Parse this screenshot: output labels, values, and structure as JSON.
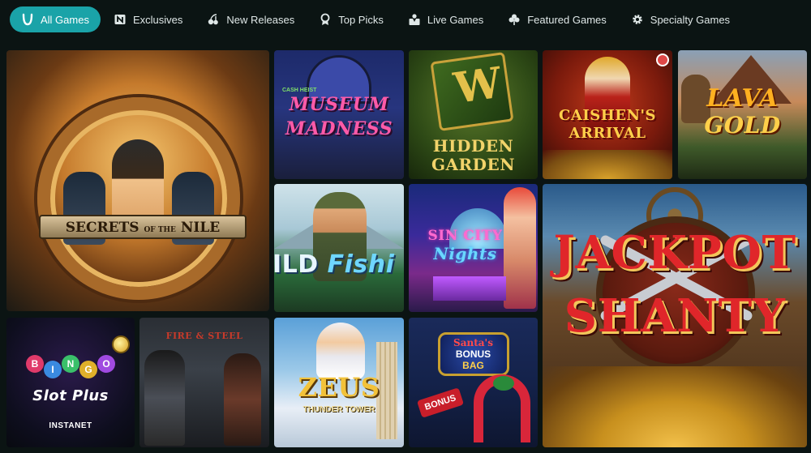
{
  "nav": {
    "items": [
      {
        "label": "All Games",
        "icon": "horseshoe-icon",
        "active": true
      },
      {
        "label": "Exclusives",
        "icon": "exclusives-badge-icon"
      },
      {
        "label": "New Releases",
        "icon": "cherries-icon"
      },
      {
        "label": "Top Picks",
        "icon": "award-ribbon-icon"
      },
      {
        "label": "Live Games",
        "icon": "live-dealer-icon"
      },
      {
        "label": "Featured Games",
        "icon": "clover-icon"
      },
      {
        "label": "Specialty Games",
        "icon": "gear-icon"
      }
    ]
  },
  "colors": {
    "background": "#0b1413",
    "accent": "#1aa3a8"
  },
  "games": {
    "secrets_nile": {
      "title_main": "SECRETS",
      "title_of": "OF THE",
      "title_end": "NILE"
    },
    "museum": {
      "tag": "CASH HEIST",
      "line1": "MUSEUM",
      "line2": "MADNESS"
    },
    "hidden_garden": {
      "line1": "HIDDEN",
      "line2": "GARDEN"
    },
    "caishens": {
      "line1": "CAISHEN'S",
      "line2": "ARRIVAL"
    },
    "lava_gold": {
      "line1": "LAVA",
      "line2": "GOLD"
    },
    "wild_fishin": {
      "line1": "ILD",
      "line2": "Fishi"
    },
    "sin_city": {
      "line1": "SIN CITY",
      "line2": "Nights"
    },
    "jackpot_shanty": {
      "line1": "JACKPOT",
      "line2": "SHANTY"
    },
    "bingo": {
      "letters": [
        "B",
        "I",
        "N",
        "G",
        "O"
      ],
      "line2": "Slot Plus",
      "footer": "INSTANET"
    },
    "fire_steel": {
      "line1": "FIRE & STEEL"
    },
    "zeus": {
      "line1": "ZEUS",
      "line2": "THUNDER TOWER"
    },
    "santas": {
      "line1": "Santa's",
      "line2": "BONUS",
      "line3": "BAG",
      "badge": "BONUS"
    }
  }
}
